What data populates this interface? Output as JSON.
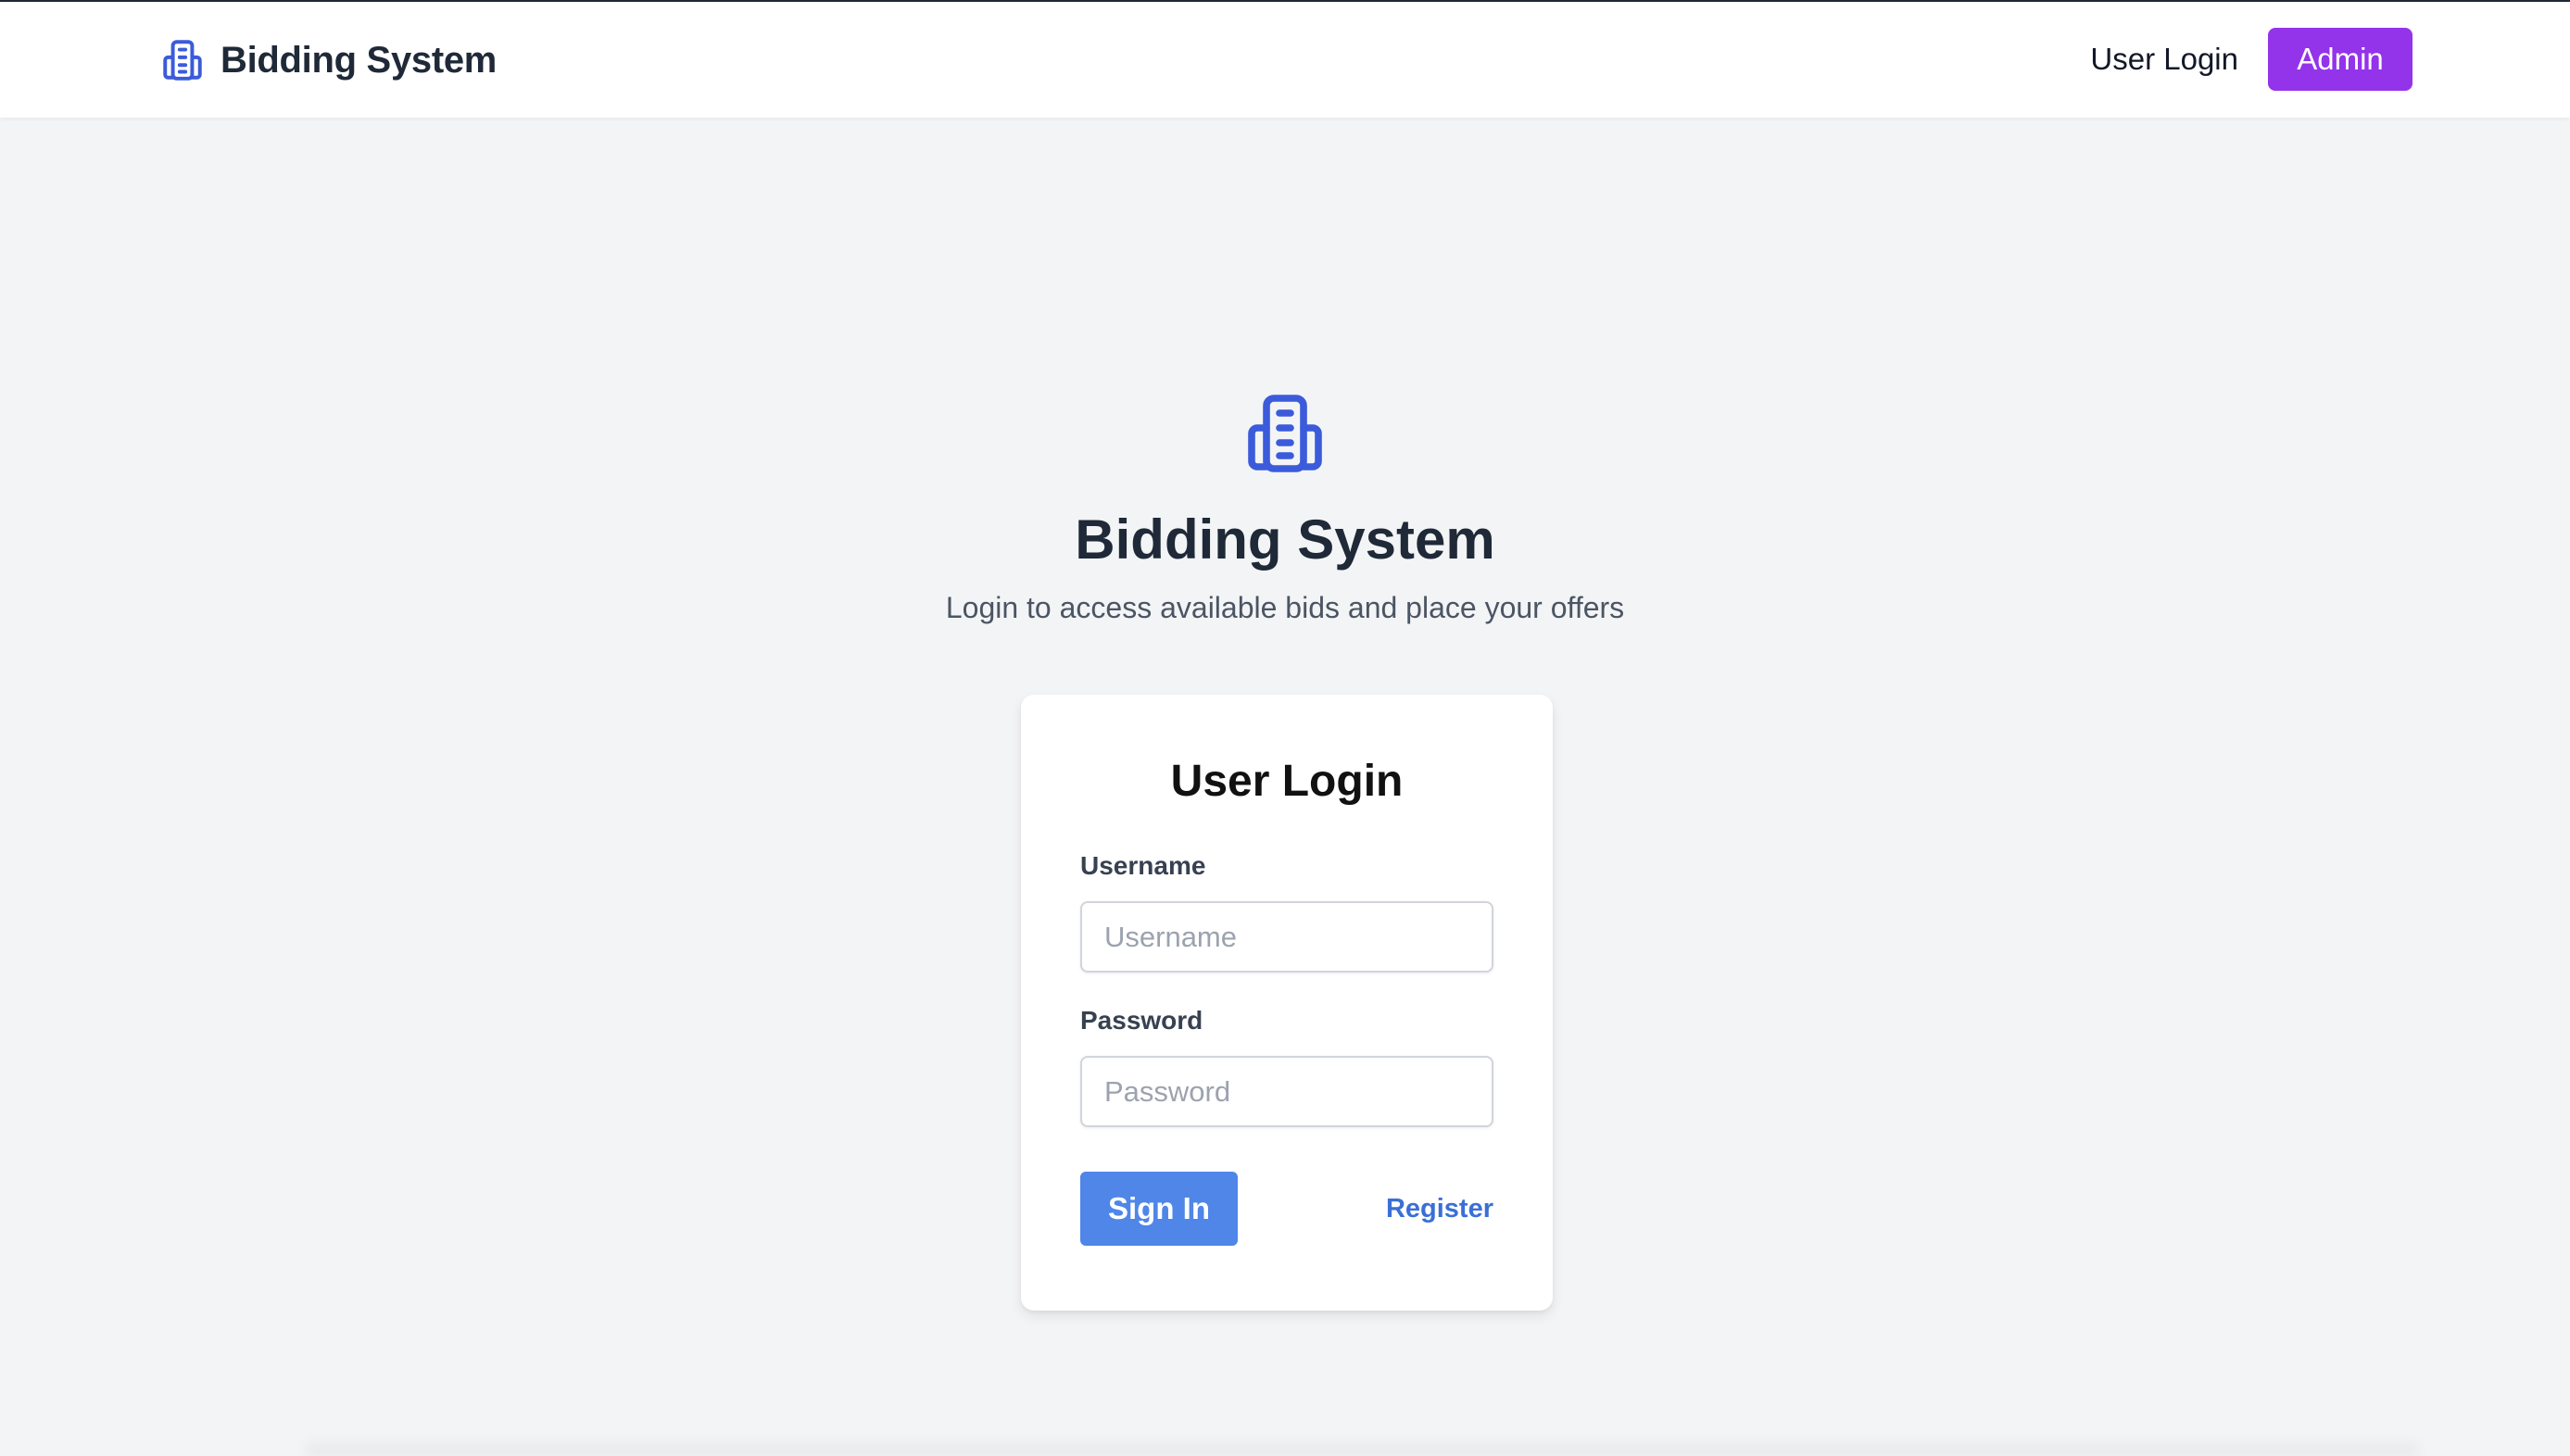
{
  "navbar": {
    "brand_title": "Bidding System",
    "brand_icon": "building-icon",
    "user_login_label": "User Login",
    "admin_label": "Admin"
  },
  "hero": {
    "icon": "building-icon",
    "title": "Bidding System",
    "subtitle": "Login to access available bids and place your offers"
  },
  "login_card": {
    "title": "User Login",
    "username_label": "Username",
    "username_placeholder": "Username",
    "username_value": "",
    "password_label": "Password",
    "password_placeholder": "Password",
    "password_value": "",
    "signin_label": "Sign In",
    "register_label": "Register"
  },
  "colors": {
    "brand_blue": "#3b5bdb",
    "admin_purple": "#9333ea",
    "signin_blue": "#4f86e8",
    "link_blue": "#3b6fd6",
    "background": "#f3f4f6"
  }
}
